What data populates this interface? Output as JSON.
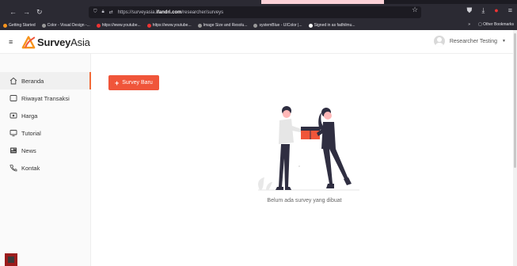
{
  "browser": {
    "url_prefix": "https://surveyasia.",
    "url_host": "ifandri.com",
    "url_path": "/researcher/surveys",
    "bookmarks": [
      {
        "label": "Getting Started"
      },
      {
        "label": "Color - Visual Design -..."
      },
      {
        "label": "https://www.youtube..."
      },
      {
        "label": "https://www.youtube..."
      },
      {
        "label": "Image Size and Resolu..."
      },
      {
        "label": "systemBlue - UIColor |..."
      },
      {
        "label": "Signed in as fadhilmu..."
      }
    ],
    "other_bookmarks": "Other Bookmarks"
  },
  "header": {
    "logo_bold": "Survey",
    "logo_light": "Asia",
    "user_name": "Researcher Testing"
  },
  "sidebar": {
    "items": [
      {
        "label": "Beranda",
        "icon": "home-icon"
      },
      {
        "label": "Riwayat Transaksi",
        "icon": "receipt-icon"
      },
      {
        "label": "Harga",
        "icon": "price-tag-icon"
      },
      {
        "label": "Tutorial",
        "icon": "monitor-icon"
      },
      {
        "label": "News",
        "icon": "newspaper-icon"
      },
      {
        "label": "Kontak",
        "icon": "phone-icon"
      }
    ]
  },
  "main": {
    "new_button": "Survey Baru",
    "empty_message": "Belum ada survey yang dibuat"
  },
  "colors": {
    "accent": "#f0553a",
    "logo_orange": "#f7941d"
  }
}
